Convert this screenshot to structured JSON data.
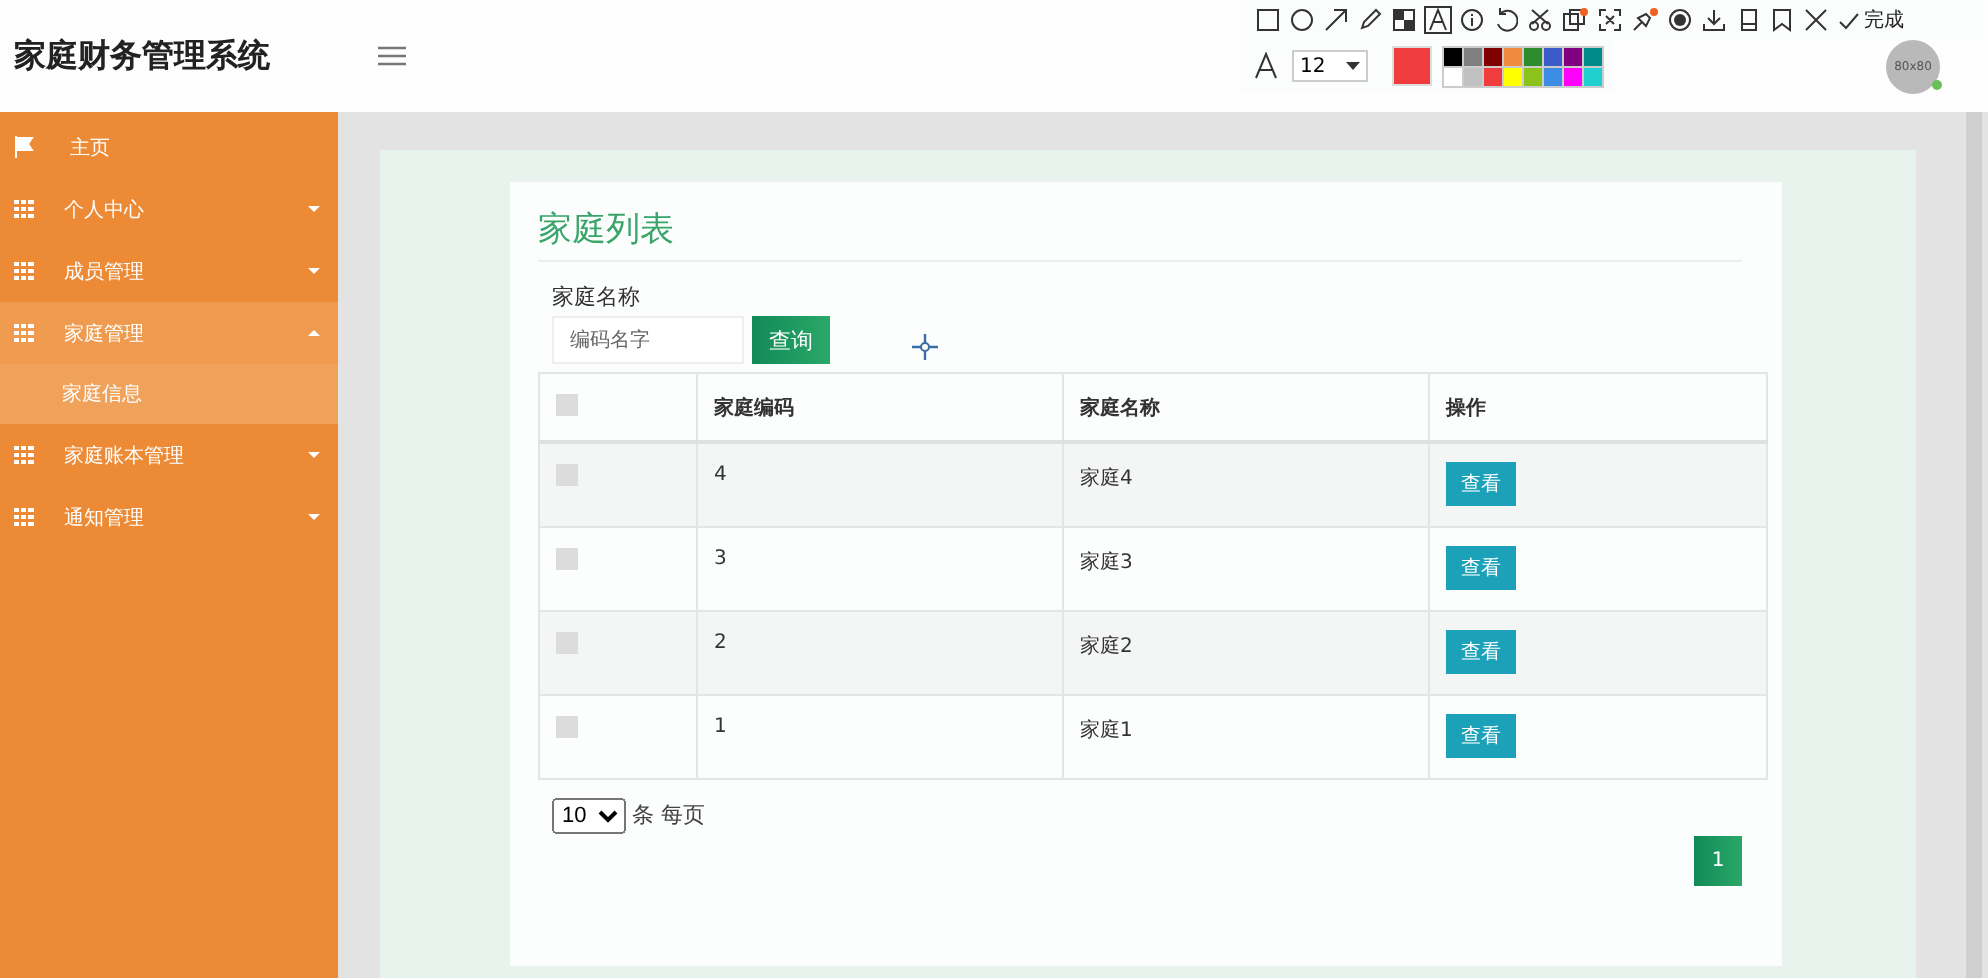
{
  "header": {
    "title": "家庭财务管理系统",
    "avatar_text": "80x80"
  },
  "annotation_toolbar": {
    "done_label": "完成",
    "font_size": "12",
    "current": {
      "color": "#f03c3c"
    },
    "palette": [
      {
        "color": "#000000"
      },
      {
        "color": "#808080"
      },
      {
        "color": "#800000"
      },
      {
        "color": "#f08a3c"
      },
      {
        "color": "#2e8b2e"
      },
      {
        "color": "#3b5bc9"
      },
      {
        "color": "#800080"
      },
      {
        "color": "#008b8b"
      },
      {
        "color": "#ffffff"
      },
      {
        "color": "#c0c0c0"
      },
      {
        "color": "#f03c3c"
      },
      {
        "color": "#ffff00"
      },
      {
        "color": "#8bc31a"
      },
      {
        "color": "#3c8ce6"
      },
      {
        "color": "#ff00ff"
      },
      {
        "color": "#20d0d0"
      }
    ]
  },
  "sidebar": {
    "items": [
      {
        "kind": "link",
        "label": "主页"
      },
      {
        "kind": "menu",
        "label": "个人中心",
        "expanded": false
      },
      {
        "kind": "menu",
        "label": "成员管理",
        "expanded": false
      },
      {
        "kind": "menu",
        "label": "家庭管理",
        "expanded": true,
        "children": [
          {
            "label": "家庭信息",
            "selected": true
          }
        ]
      },
      {
        "kind": "menu",
        "label": "家庭账本管理",
        "expanded": false
      },
      {
        "kind": "menu",
        "label": "通知管理",
        "expanded": false
      }
    ]
  },
  "card": {
    "title": "家庭列表",
    "search": {
      "label": "家庭名称",
      "placeholder": "编码名字",
      "button": "查询"
    },
    "table": {
      "header_checked": false,
      "columns": [
        "家庭编码",
        "家庭名称",
        "操作"
      ],
      "rows": [
        {
          "checked": false,
          "code": "4",
          "name": "家庭4",
          "action": "查看"
        },
        {
          "checked": false,
          "code": "3",
          "name": "家庭3",
          "action": "查看"
        },
        {
          "checked": false,
          "code": "2",
          "name": "家庭2",
          "action": "查看"
        },
        {
          "checked": false,
          "code": "1",
          "name": "家庭1",
          "action": "查看"
        }
      ]
    },
    "page_size": {
      "value": "10",
      "suffix": "条 每页"
    },
    "pages": [
      {
        "label": "1",
        "selected": true
      }
    ]
  }
}
